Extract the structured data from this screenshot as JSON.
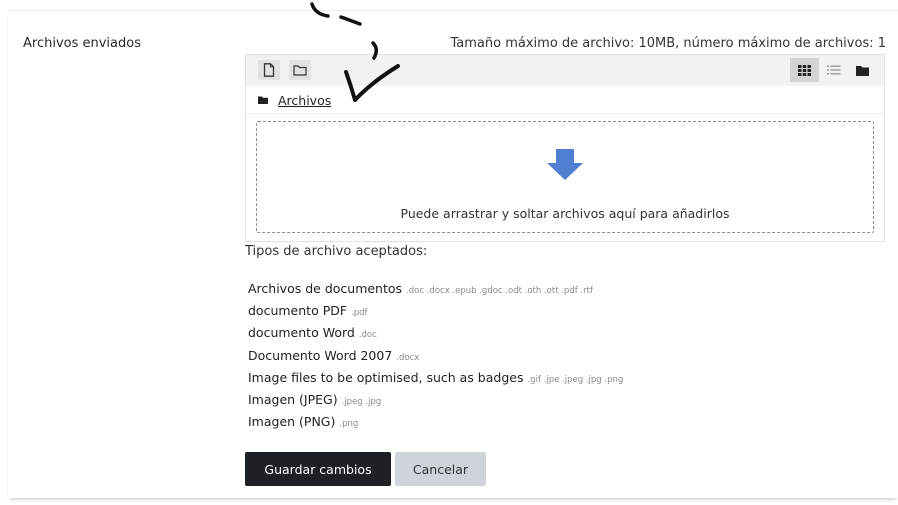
{
  "field": {
    "label": "Archivos enviados",
    "limits": "Tamaño máximo de archivo: 10MB, número máximo de archivos: 1"
  },
  "filemanager": {
    "toolbar": {
      "icons": [
        "add-file-icon",
        "create-folder-icon"
      ],
      "views": [
        {
          "icon": "grid-view-icon",
          "active": true
        },
        {
          "icon": "list-view-icon",
          "active": false
        },
        {
          "icon": "folder-tree-view-icon",
          "active": false
        }
      ]
    },
    "path_label": "Archivos",
    "drop_text": "Puede arrastrar y soltar archivos aquí para añadirlos"
  },
  "accepted": {
    "title": "Tipos de archivo aceptados:",
    "types": [
      {
        "name": "Archivos de documentos",
        "ext": ".doc .docx .epub .gdoc .odt .oth .ott .pdf .rtf"
      },
      {
        "name": "documento PDF",
        "ext": ".pdf"
      },
      {
        "name": "documento Word",
        "ext": ".doc"
      },
      {
        "name": "Documento Word 2007",
        "ext": ".docx"
      },
      {
        "name": "Image files to be optimised, such as badges",
        "ext": ".gif .jpe .jpeg .jpg .png"
      },
      {
        "name": "Imagen (JPEG)",
        "ext": ".jpeg .jpg"
      },
      {
        "name": "Imagen (PNG)",
        "ext": ".png"
      }
    ]
  },
  "buttons": {
    "save": "Guardar cambios",
    "cancel": "Cancelar"
  },
  "colors": {
    "arrow": "#4f7fd1",
    "primary_button": "#1d2125",
    "secondary_button": "#ced4da"
  }
}
